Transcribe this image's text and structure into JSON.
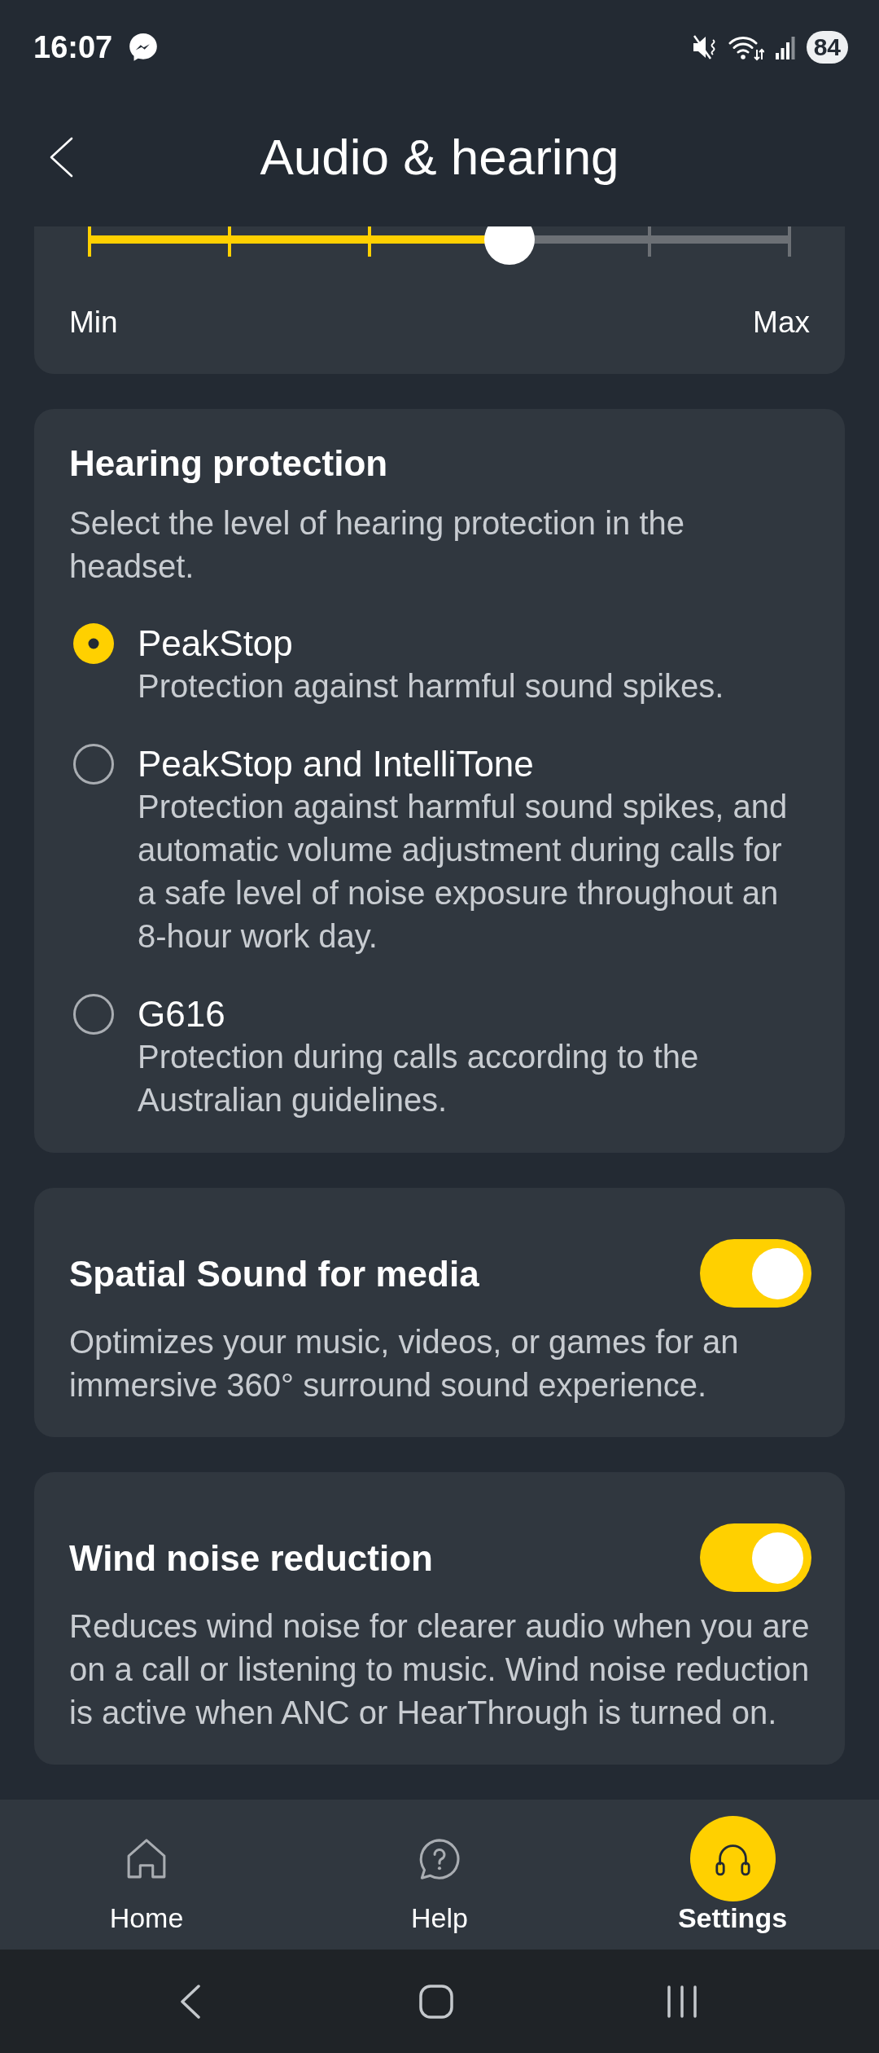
{
  "status_bar": {
    "time": "16:07",
    "battery": "84"
  },
  "header": {
    "title": "Audio & hearing"
  },
  "slider_card": {
    "slider": {
      "level": 0.6
    },
    "min_label": "Min",
    "max_label": "Max"
  },
  "hearing_protection": {
    "title": "Hearing protection",
    "description": "Select the level of hearing protection in the headset.",
    "options": [
      {
        "label": "PeakStop",
        "description": "Protection against harmful sound spikes.",
        "selected": true
      },
      {
        "label": "PeakStop and IntelliTone",
        "description": "Protection against harmful sound spikes, and automatic volume adjustment during calls for a safe level of noise exposure throughout an 8-hour work day.",
        "selected": false
      },
      {
        "label": "G616",
        "description": "Protection during calls according to the Australian guidelines.",
        "selected": false
      }
    ]
  },
  "feature_cards": [
    {
      "title": "Spatial Sound for media",
      "description": "Optimizes your music, videos, or games for an immersive 360° surround sound experience.",
      "on": true
    },
    {
      "title": "Wind noise reduction",
      "description": "Reduces wind noise for clearer audio when you are on a call or listening to music. Wind noise reduction is active when ANC or HearThrough is turned on.",
      "on": true
    }
  ],
  "bottom_nav": [
    {
      "label": "Home",
      "selected": false
    },
    {
      "label": "Help",
      "selected": false
    },
    {
      "label": "Settings",
      "selected": true
    }
  ]
}
